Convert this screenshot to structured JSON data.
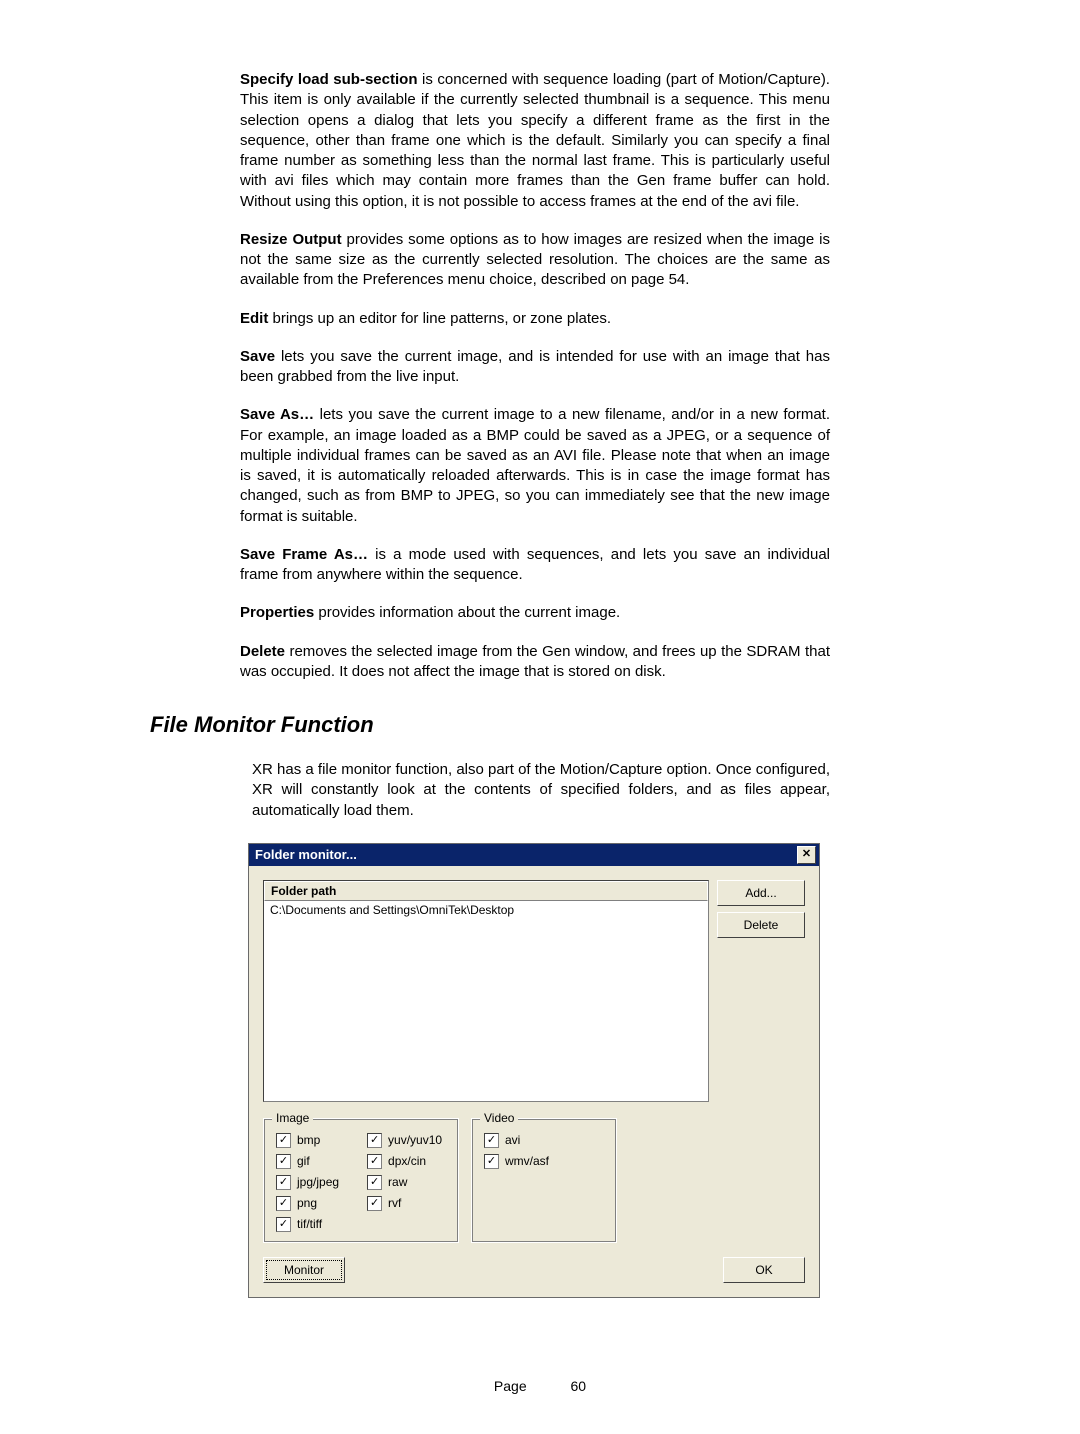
{
  "paragraphs": {
    "p1": {
      "lead": "Specify load sub-section",
      "text": " is concerned with sequence loading (part of Motion/Capture). This item is only available if the currently selected thumbnail is a sequence. This menu selection opens a dialog that lets you specify a different frame as the first in the sequence, other than frame one which is the default. Similarly you can specify a final frame number as something less than the normal last frame. This is particularly useful with avi files which may contain more frames than the Gen frame buffer can hold. Without using this option, it is not possible to access frames at the end of the avi file."
    },
    "p2": {
      "lead": "Resize Output",
      "text": " provides some options as to how images are resized when the image is not the same size as the currently selected resolution. The choices are the same as available from the Preferences menu choice, described on page 54."
    },
    "p3": {
      "lead": "Edit",
      "text": " brings up an editor for line patterns, or zone plates."
    },
    "p4": {
      "lead": "Save",
      "text": " lets you save the current image, and is intended for use with an image that has been grabbed from the live input."
    },
    "p5": {
      "lead": "Save As…",
      "text": " lets you save the current image to a new filename, and/or in a new format. For example, an image loaded as a BMP could be saved as a JPEG, or a sequence of multiple individual frames can be saved as an AVI file. Please note that when an image is saved, it is automatically reloaded afterwards. This is in case the image format has changed, such as from BMP to JPEG, so you can immediately see that the new image format is suitable."
    },
    "p6": {
      "lead": "Save Frame As…",
      "text": " is a mode used with sequences, and lets you save an individual frame from anywhere within the sequence."
    },
    "p7": {
      "lead": "Properties",
      "text": " provides information about the current image."
    },
    "p8": {
      "lead": "Delete",
      "text": " removes the selected image from the Gen window, and frees up the SDRAM that was occupied. It does not affect the image that is stored on disk."
    }
  },
  "section_heading": "File Monitor Function",
  "intro_paragraph": "XR has a file monitor function, also part of the Motion/Capture option. Once configured, XR will constantly look at the contents of specified folders, and as files appear, automatically load them.",
  "dialog": {
    "title": "Folder monitor...",
    "close_glyph": "✕",
    "list_header": "Folder path",
    "list_row0": "C:\\Documents and Settings\\OmniTek\\Desktop",
    "buttons": {
      "add": "Add...",
      "delete": "Delete",
      "monitor": "Monitor",
      "ok": "OK"
    },
    "groups": {
      "image_legend": "Image",
      "video_legend": "Video"
    },
    "checks": {
      "bmp": "bmp",
      "gif": "gif",
      "jpg": "jpg/jpeg",
      "png": "png",
      "tif": "tif/tiff",
      "yuv": "yuv/yuv10",
      "dpx": "dpx/cin",
      "raw": "raw",
      "rvf": "rvf",
      "avi": "avi",
      "wmv": "wmv/asf"
    },
    "check_glyph": "✓"
  },
  "footer": {
    "label": "Page",
    "number": "60"
  }
}
